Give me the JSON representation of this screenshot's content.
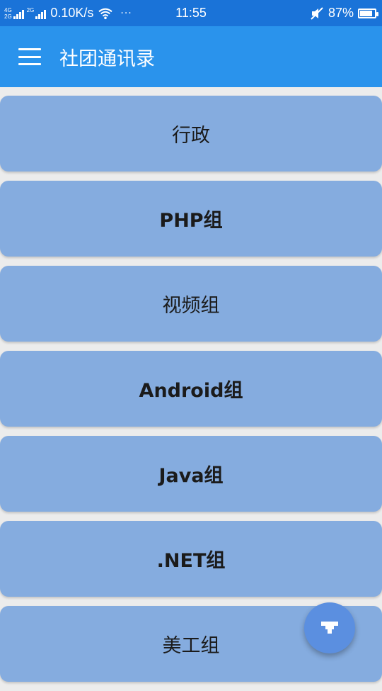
{
  "status_bar": {
    "net_top": "4G",
    "net_bottom": "2G",
    "net_extra": "2G",
    "speed": "0.10K/s",
    "dots": "···",
    "time": "11:55",
    "battery": "87%",
    "battery_level": 0.87
  },
  "app_bar": {
    "title": "社团通讯录",
    "menu_icon": "hamburger-menu-icon"
  },
  "groups": [
    {
      "label": "行政"
    },
    {
      "label": "PHP组"
    },
    {
      "label": "视频组"
    },
    {
      "label": "Android组"
    },
    {
      "label": "Java组"
    },
    {
      "label": ".NET组"
    },
    {
      "label": "美工组"
    }
  ],
  "fab": {
    "icon": "filter-icon"
  },
  "colors": {
    "status_bar": "#1a73d8",
    "app_bar": "#2a93ec",
    "card": "#85acdf",
    "fab": "#5b8fe0",
    "background": "#ececec"
  }
}
